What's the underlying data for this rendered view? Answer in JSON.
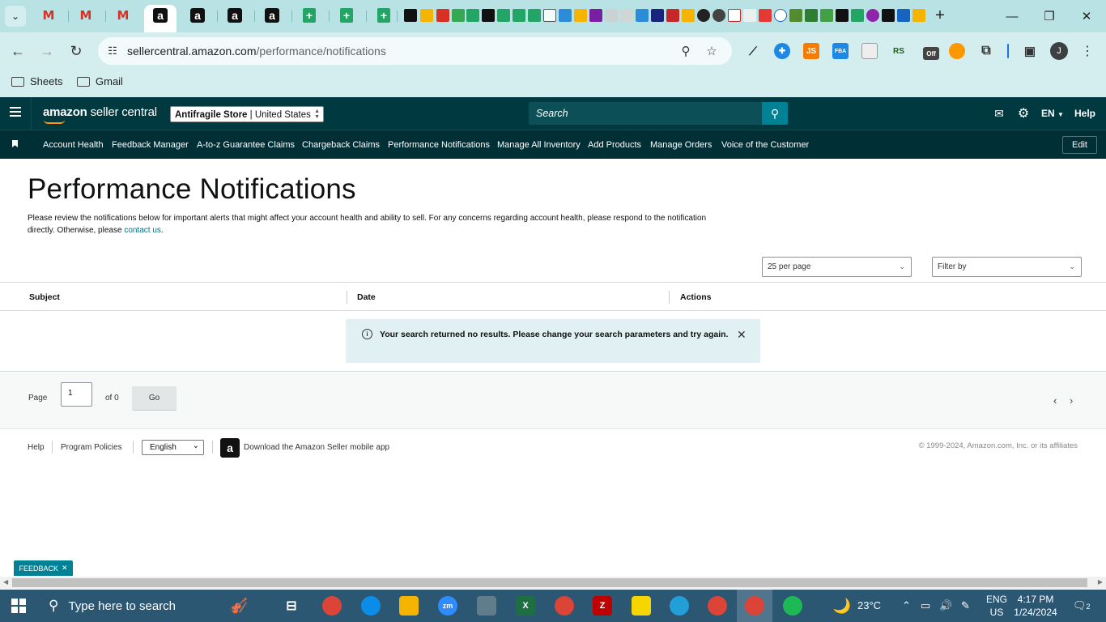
{
  "browser": {
    "url_host": "sellercentral.amazon.com",
    "url_path": "/performance/notifications",
    "bookmarks": [
      "Sheets",
      "Gmail"
    ],
    "profile_initial": "J",
    "extensions": [
      "JS",
      "FBA",
      "RS",
      "Off"
    ]
  },
  "header": {
    "logo_bold": "amazon",
    "logo_light": " seller central",
    "store_name": "Antifragile Store",
    "store_region": "United States",
    "search_placeholder": "Search",
    "language": "EN",
    "help": "Help"
  },
  "nav": {
    "links": [
      "Account Health",
      "Feedback Manager",
      "A-to-z Guarantee Claims",
      "Chargeback Claims",
      "Performance Notifications",
      "Manage All Inventory",
      "Add Products",
      "Manage Orders",
      "Voice of the Customer"
    ],
    "edit": "Edit"
  },
  "page": {
    "title": "Performance Notifications",
    "intro": "Please review the notifications below for important alerts that might affect your account health and ability to sell. For any concerns regarding account health, please respond to the notification directly. Otherwise, please ",
    "intro_link": "contact us",
    "intro_end": ".",
    "per_page": "25 per page",
    "filter": "Filter by"
  },
  "table": {
    "columns": [
      "Subject",
      "Date",
      "Actions"
    ],
    "empty_message": "Your search returned no results. Please change your search parameters and try again."
  },
  "pager": {
    "page_label": "Page",
    "page_value": "1",
    "of_label": "of 0",
    "go": "Go"
  },
  "footer": {
    "help": "Help",
    "policies": "Program Policies",
    "language": "English",
    "app_text": "Download the Amazon Seller mobile app",
    "copyright": "© 1999-2024, Amazon.com, Inc. or its affiliates"
  },
  "feedback": "FEEDBACK",
  "taskbar": {
    "search_placeholder": "Type here to search",
    "weather": "23°C",
    "lang_line1": "ENG",
    "lang_line2": "US",
    "time": "4:17 PM",
    "date": "1/24/2024",
    "notifications": "2"
  },
  "colors": {
    "header_bg": "#00393f",
    "nav_bg": "#002f36",
    "accent": "#008296",
    "alert_bg": "#e1f0f2",
    "chrome_tabstrip": "#b9e2e4"
  }
}
